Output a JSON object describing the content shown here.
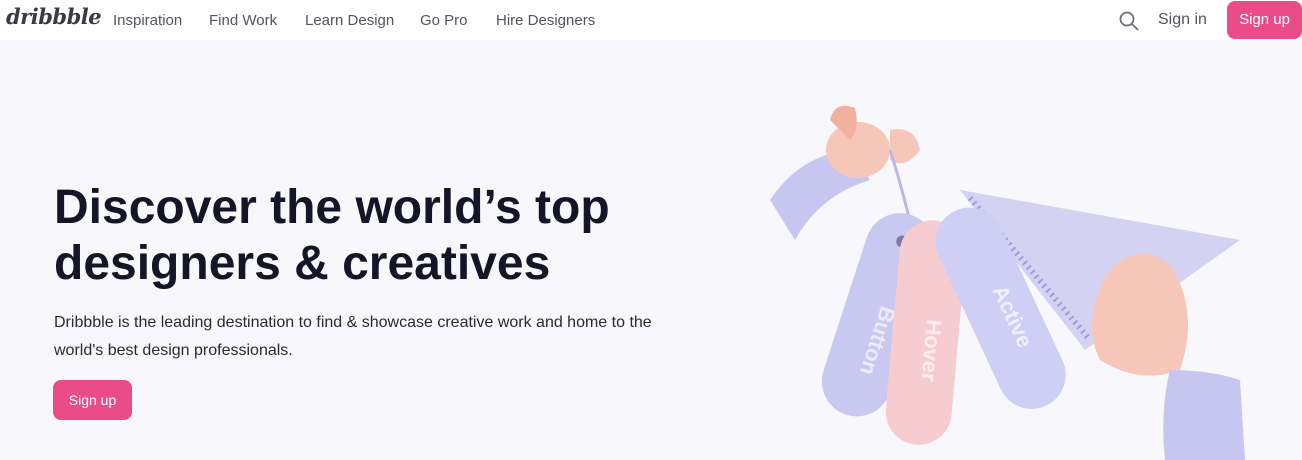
{
  "header": {
    "logo": "dribbble",
    "nav": [
      "Inspiration",
      "Find Work",
      "Learn Design",
      "Go Pro",
      "Hire Designers"
    ],
    "search_icon": "search-icon",
    "signin_label": "Sign in",
    "signup_label": "Sign up"
  },
  "hero": {
    "title_line1": "Discover the world’s top",
    "title_line2": "designers & creatives",
    "desc_line1": "Dribbble is the leading destination to find & showcase creative work and home to the",
    "desc_line2": "world's best design professionals.",
    "signup_label": "Sign up"
  },
  "illustration": {
    "tags": [
      "Button",
      "Hover",
      "Active"
    ]
  },
  "colors": {
    "brand_pink": "#ea4c89",
    "heading": "#151528",
    "background": "#f8f7fb"
  }
}
